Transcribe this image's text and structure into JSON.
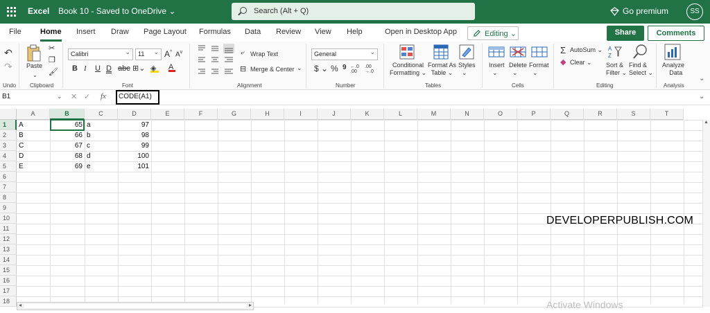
{
  "titlebar": {
    "app_name": "Excel",
    "doc_title": "Book 10 - Saved to OneDrive ⌄",
    "search_placeholder": "Search (Alt + Q)",
    "premium": "Go premium",
    "user_initials": "SS"
  },
  "menu": {
    "tabs": [
      "File",
      "Home",
      "Insert",
      "Draw",
      "Page Layout",
      "Formulas",
      "Data",
      "Review",
      "View",
      "Help",
      "Open in Desktop App"
    ],
    "active_tab": "Home",
    "editing_label": "Editing",
    "share_label": "Share",
    "comments_label": "Comments"
  },
  "ribbon": {
    "groups": [
      "Undo",
      "Clipboard",
      "Font",
      "Alignment",
      "Number",
      "Tables",
      "Cells",
      "Editing",
      "Analysis"
    ],
    "paste_label": "Paste",
    "font_name": "Calibri",
    "font_size": "11",
    "wrap_text": "Wrap Text",
    "merge_center": "Merge & Center",
    "number_format": "General",
    "conditional_formatting": [
      "Conditional",
      "Formatting"
    ],
    "format_as_table": [
      "Format As",
      "Table"
    ],
    "styles": "Styles",
    "insert": "Insert",
    "delete": "Delete",
    "format": "Format",
    "autosum": "AutoSum",
    "clear": "Clear",
    "sort_filter": [
      "Sort &",
      "Filter"
    ],
    "find_select": [
      "Find &",
      "Select"
    ],
    "analyze_data": [
      "Analyze",
      "Data"
    ]
  },
  "formula_bar": {
    "name_box": "B1",
    "formula": "CODE(A1)"
  },
  "sheet": {
    "columns": [
      "A",
      "B",
      "C",
      "D",
      "E",
      "F",
      "G",
      "H",
      "I",
      "J",
      "K",
      "L",
      "M",
      "N",
      "O",
      "P",
      "Q",
      "R",
      "S",
      "T"
    ],
    "rows": [
      "1",
      "2",
      "3",
      "4",
      "5",
      "6",
      "7",
      "8",
      "9",
      "10",
      "11",
      "12",
      "13",
      "14",
      "15",
      "16",
      "17",
      "18"
    ],
    "selected_column": "B",
    "selected_row": "1",
    "data": [
      [
        "A",
        "65",
        "a",
        "97"
      ],
      [
        "B",
        "66",
        "b",
        "98"
      ],
      [
        "C",
        "67",
        "c",
        "99"
      ],
      [
        "D",
        "68",
        "d",
        "100"
      ],
      [
        "E",
        "69",
        "e",
        "101"
      ]
    ]
  },
  "watermark": "DEVELOPERPUBLISH.COM",
  "os_notice": "Activate Windows"
}
